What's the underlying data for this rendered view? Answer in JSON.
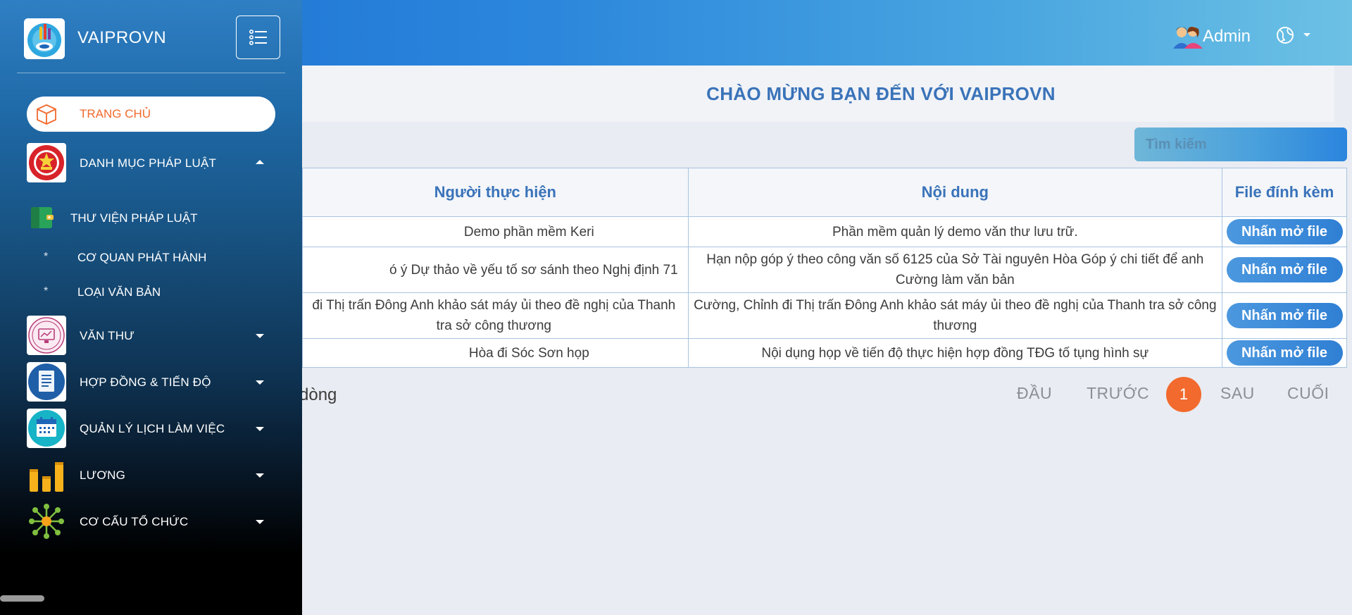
{
  "brand": {
    "name": "VAIPROVN"
  },
  "header": {
    "user_label": "Admin"
  },
  "welcome": {
    "title": "CHÀO MỪNG BẠN ĐẾN VỚI VAIPROVN"
  },
  "search": {
    "placeholder": "Tìm kiếm"
  },
  "sidebar": {
    "home": "TRANG CHỦ",
    "items": [
      {
        "label": "DANH MỤC PHÁP LUẬT",
        "expanded": true
      },
      {
        "label": "VĂN THƯ",
        "expanded": false
      },
      {
        "label": "HỢP ĐỒNG & TIẾN ĐỘ",
        "expanded": false
      },
      {
        "label": "QUẢN LÝ LỊCH LÀM VIỆC",
        "expanded": false
      },
      {
        "label": "LƯƠNG",
        "expanded": false
      },
      {
        "label": "CƠ CẤU TỔ CHỨC",
        "expanded": false
      }
    ],
    "submenu": {
      "library": "THƯ VIỆN PHÁP LUẬT",
      "children": [
        "CƠ QUAN PHÁT HÀNH",
        "LOẠI VĂN BẢN"
      ],
      "bullet": "*"
    }
  },
  "table": {
    "columns": [
      "Người thực hiện",
      "Nội dung",
      "File đính kèm"
    ],
    "rows": [
      {
        "person": "Demo phần mềm Keri",
        "content": "Phần mềm quản lý demo văn thư lưu trữ.",
        "file": "Nhấn mở file"
      },
      {
        "person": "ó ý Dự thảo về yếu tố sơ sánh theo Nghị định 71",
        "content": "Hạn nộp góp ý theo công văn số 6125 của Sở Tài nguyên Hòa Góp ý chi tiết để anh Cường làm văn bản",
        "file": "Nhấn mở file"
      },
      {
        "person": "đi Thị trấn Đông Anh khảo sát máy ủi theo đề nghị của Thanh tra sở công thương",
        "content": "Cường, Chỉnh đi Thị trấn Đông Anh khảo sát máy ủi theo đề nghị của Thanh tra sở công thương",
        "file": "Nhấn mở file"
      },
      {
        "person": "Hòa đi Sóc Sơn họp",
        "content": "Nội dụng họp về tiến độ thực hiện hợp đồng TĐG tố tụng hình sự",
        "file": "Nhấn mở file"
      }
    ]
  },
  "footer": {
    "rows_text": "dòng"
  },
  "pagination": {
    "first": "ĐẦU",
    "prev": "TRƯỚC",
    "current": "1",
    "next": "SAU",
    "last": "CUỐI"
  },
  "colors": {
    "accent": "#f26a2d",
    "primary": "#3a73b9",
    "header_start": "#1b6fd1",
    "header_end": "#6cc1e4"
  }
}
